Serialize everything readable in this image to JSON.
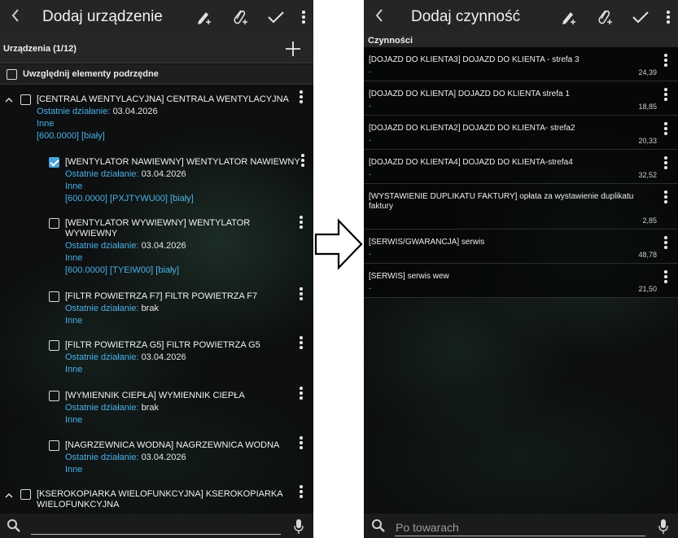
{
  "left": {
    "title": "Dodaj urządzenie",
    "section": "Urządzenia (1/12)",
    "include_children": "Uwzględnij elementy podrzędne",
    "meta_label": "Ostatnie działanie:",
    "devices": [
      {
        "name_1": "[CENTRALA WENTYLACYJNA] CENTRALA WENTYLACYJNA",
        "name_2": "",
        "last": "03.04.2026",
        "type": "Inne",
        "tags": "[600.0000]  [biały]",
        "checked": false,
        "level": 0
      },
      {
        "name_1": "[WENTYLATOR NAWIEWNY] WENTYLATOR NAWIEWNY",
        "name_2": "",
        "last": "03.04.2026",
        "type": "Inne",
        "tags": "[600.0000]  [PXJTYWU00]  [biały]",
        "checked": true,
        "level": 1
      },
      {
        "name_1": "[WENTYLATOR WYWIEWNY] WENTYLATOR",
        "name_2": "WYWIEWNY",
        "last": "03.04.2026",
        "type": "Inne",
        "tags": "[600.0000]  [TYEIW00]  [biały]",
        "checked": false,
        "level": 1
      },
      {
        "name_1": "[FILTR POWIETRZA F7] FILTR POWIETRZA F7",
        "name_2": "",
        "last": "brak",
        "type": "Inne",
        "tags": "",
        "checked": false,
        "level": 1
      },
      {
        "name_1": "[FILTR POWIETRZA G5] FILTR POWIETRZA G5",
        "name_2": "",
        "last": "03.04.2026",
        "type": "Inne",
        "tags": "",
        "checked": false,
        "level": 1
      },
      {
        "name_1": "[WYMIENNIK CIEPŁA] WYMIENNIK CIEPŁA",
        "name_2": "",
        "last": "brak",
        "type": "Inne",
        "tags": "",
        "checked": false,
        "level": 1
      },
      {
        "name_1": "[NAGRZEWNICA WODNA] NAGRZEWNICA WODNA",
        "name_2": "",
        "last": "03.04.2026",
        "type": "Inne",
        "tags": "",
        "checked": false,
        "level": 1
      },
      {
        "name_1": "[KSEROKOPIARKA WIELOFUNKCYJNA] KSEROKOPIARKA",
        "name_2": "WIELOFUNKCYJNA",
        "last": "",
        "type": "",
        "tags": "",
        "checked": false,
        "level": 0
      }
    ]
  },
  "right": {
    "title": "Dodaj czynność",
    "section": "Czynności",
    "search_placeholder": "Po towarach",
    "tasks": [
      {
        "name": "[DOJAZD DO KLIENTA3] DOJAZD DO KLIENTA - strefa 3",
        "dash": "-",
        "price": "24,39"
      },
      {
        "name": "[DOJAZD DO KLIENTA] DOJAZD DO KLIENTA strefa 1",
        "dash": "-",
        "price": "18,85"
      },
      {
        "name": "[DOJAZD DO KLIENTA2] DOJAZD DO KLIENTA- strefa2",
        "dash": "-",
        "price": "20,33"
      },
      {
        "name": "[DOJAZD DO KLIENTA4] DOJAZD DO KLIENTA-strefa4",
        "dash": "-",
        "price": "32,52"
      },
      {
        "name": "[WYSTAWIENIE DUPLIKATU FAKTURY] opłata za wystawienie duplikatu faktury",
        "dash": "-",
        "price": "2,85"
      },
      {
        "name": "[SERWIS/GWARANCJA] serwis",
        "dash": "-",
        "price": "48,78"
      },
      {
        "name": "[SERWIS] serwis wew",
        "dash": "-",
        "price": "21,50"
      }
    ]
  },
  "icons": {
    "back": "chevron-left-icon",
    "pencil": "pencil-plus-icon",
    "clip": "paperclip-plus-icon",
    "check": "checkmark-icon",
    "menu": "more-vertical-icon",
    "search": "search-icon",
    "mic": "microphone-icon",
    "arrow": "arrow-right-icon"
  },
  "colors": {
    "accent_blue": "#4ab0e8",
    "checkbox_checked": "#4aa3d8",
    "toolbar": "#242526"
  }
}
